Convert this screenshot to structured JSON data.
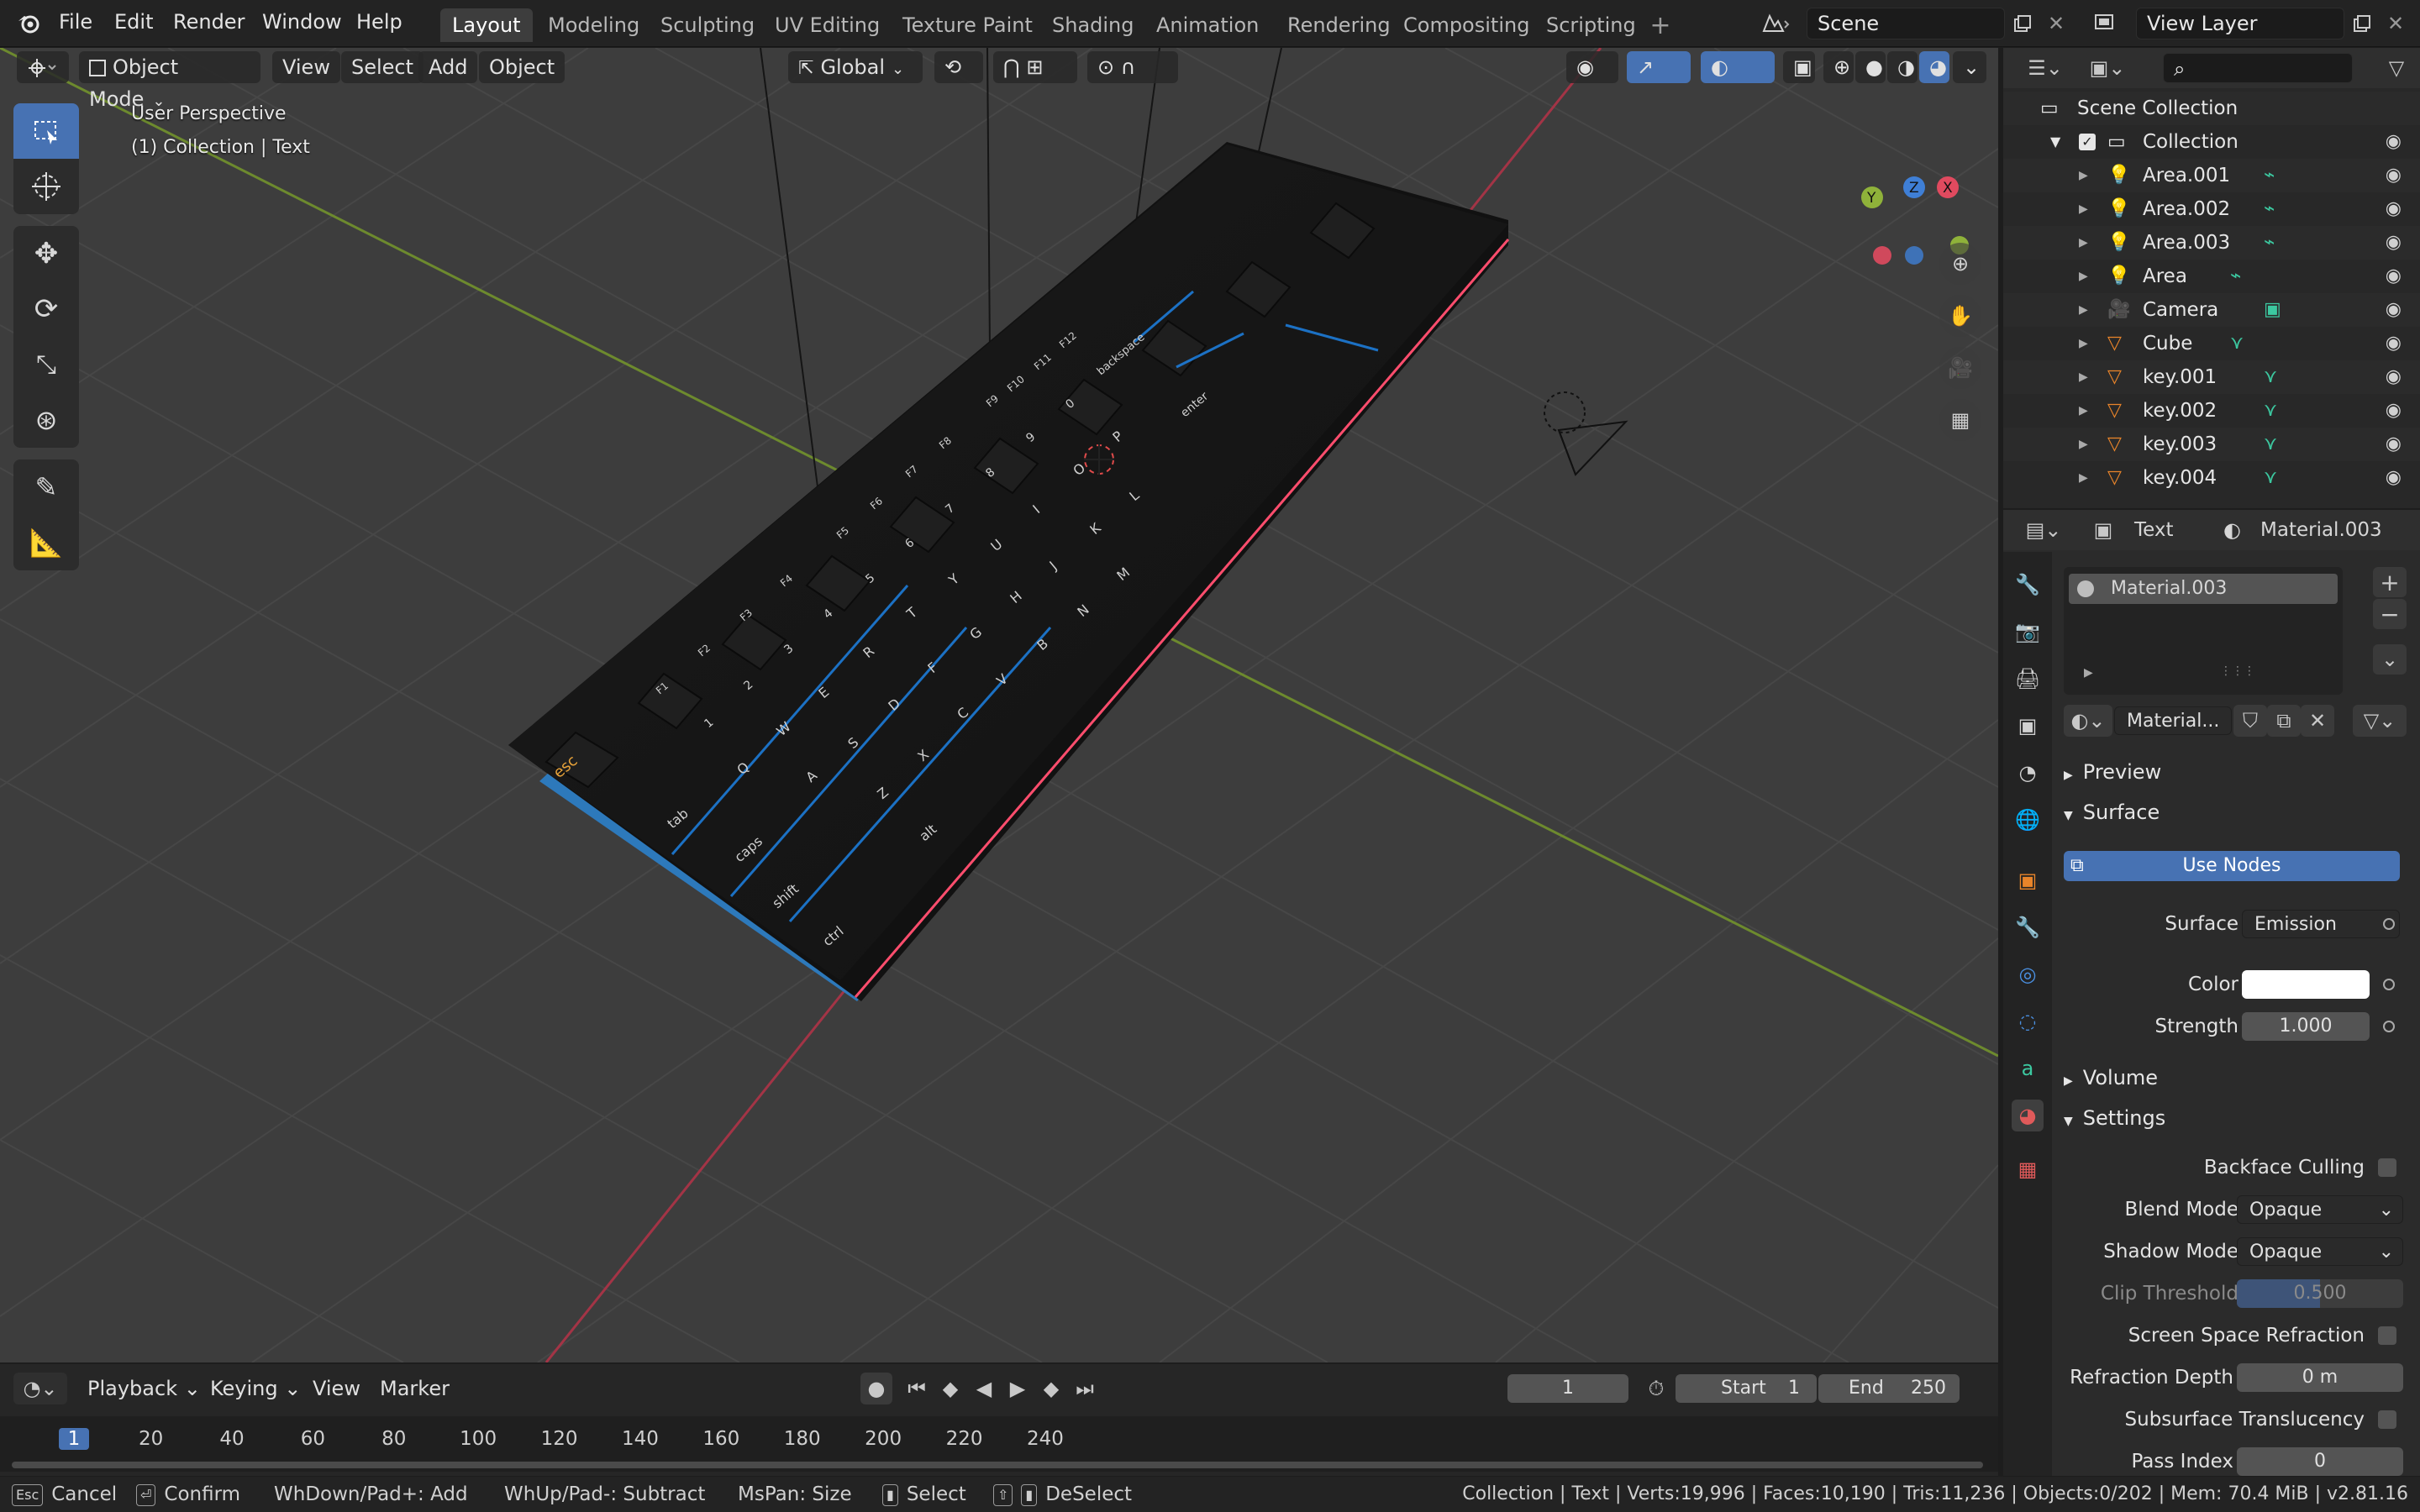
{
  "menu": {
    "items": [
      "File",
      "Edit",
      "Render",
      "Window",
      "Help"
    ],
    "workspaces": [
      "Layout",
      "Modeling",
      "Sculpting",
      "UV Editing",
      "Texture Paint",
      "Shading",
      "Animation",
      "Rendering",
      "Compositing",
      "Scripting"
    ],
    "active_workspace": "Layout",
    "scene": "Scene",
    "view_layer": "View Layer"
  },
  "viewport": {
    "mode": "Object Mode",
    "menus": [
      "View",
      "Select",
      "Add",
      "Object"
    ],
    "transform_orientation": "Global",
    "perspective_label": "User Perspective",
    "collection_label": "(1) Collection | Text",
    "gizmo": {
      "x": "X",
      "y": "Y",
      "z": "Z"
    }
  },
  "outliner": {
    "search_placeholder": "",
    "scene_collection": "Scene Collection",
    "collection": "Collection",
    "items": [
      {
        "name": "Area.001",
        "type": "light"
      },
      {
        "name": "Area.002",
        "type": "light"
      },
      {
        "name": "Area.003",
        "type": "light"
      },
      {
        "name": "Area",
        "type": "light"
      },
      {
        "name": "Camera",
        "type": "camera"
      },
      {
        "name": "Cube",
        "type": "mesh"
      },
      {
        "name": "key.001",
        "type": "mesh"
      },
      {
        "name": "key.002",
        "type": "mesh"
      },
      {
        "name": "key.003",
        "type": "mesh"
      },
      {
        "name": "key.004",
        "type": "mesh"
      }
    ]
  },
  "properties": {
    "object_name": "Text",
    "material_name": "Material.003",
    "slot_name": "Material.003",
    "material_field": "Material...",
    "sections": {
      "preview": "Preview",
      "surface": "Surface",
      "volume": "Volume",
      "settings": "Settings"
    },
    "use_nodes": "Use Nodes",
    "surface_label": "Surface",
    "surface_value": "Emission",
    "color_label": "Color",
    "color_value": "#ffffff",
    "strength_label": "Strength",
    "strength_value": "1.000",
    "backface_culling": "Backface Culling",
    "blend_mode_label": "Blend Mode",
    "blend_mode_value": "Opaque",
    "shadow_mode_label": "Shadow Mode",
    "shadow_mode_value": "Opaque",
    "clip_threshold_label": "Clip Threshold",
    "clip_threshold_value": "0.500",
    "clip_threshold_fraction": 0.5,
    "ssr_label": "Screen Space Refraction",
    "refraction_depth_label": "Refraction Depth",
    "refraction_depth_value": "0 m",
    "subsurface_label": "Subsurface Translucency",
    "pass_index_label": "Pass Index",
    "pass_index_value": "0"
  },
  "timeline": {
    "menus": [
      "Playback",
      "Keying",
      "View",
      "Marker"
    ],
    "current_frame": "1",
    "start_label": "Start",
    "start_value": "1",
    "end_label": "End",
    "end_value": "250",
    "ruler": [
      "1",
      "20",
      "40",
      "60",
      "80",
      "100",
      "120",
      "140",
      "160",
      "180",
      "200",
      "220",
      "240"
    ]
  },
  "statusbar": {
    "cancel": "Cancel",
    "confirm": "Confirm",
    "add": "WhDown/Pad+: Add",
    "subtract": "WhUp/Pad-: Subtract",
    "size": "MsPan: Size",
    "select": "Select",
    "deselect": "DeSelect",
    "esc_key": "Esc",
    "stats": "Collection | Text | Verts:19,996 | Faces:10,190 | Tris:11,236 | Objects:0/202 | Mem: 70.4 MiB | v2.81.16"
  },
  "keycap_legends": [
    "esc",
    "tab",
    "caps",
    "shift",
    "ctrl",
    "alt",
    "Q",
    "W",
    "E",
    "R",
    "T",
    "Y",
    "U",
    "I",
    "O",
    "P",
    "A",
    "S",
    "D",
    "F",
    "G",
    "H",
    "J",
    "K",
    "L",
    "Z",
    "X",
    "C",
    "V",
    "B",
    "N",
    "M",
    "enter",
    "backspace",
    "F1",
    "F2",
    "F3",
    "F4",
    "F5",
    "F6",
    "F7",
    "F8",
    "F9",
    "F10",
    "F11",
    "F12",
    "1",
    "2",
    "3",
    "4",
    "5",
    "6",
    "7",
    "8",
    "9",
    "0"
  ],
  "colors": {
    "accent": "#4772b3",
    "x_axis": "#e04a5f",
    "y_axis": "#8fb23a",
    "z_axis": "#3f7fd6",
    "keyboard_glow": "#1e90ff"
  }
}
